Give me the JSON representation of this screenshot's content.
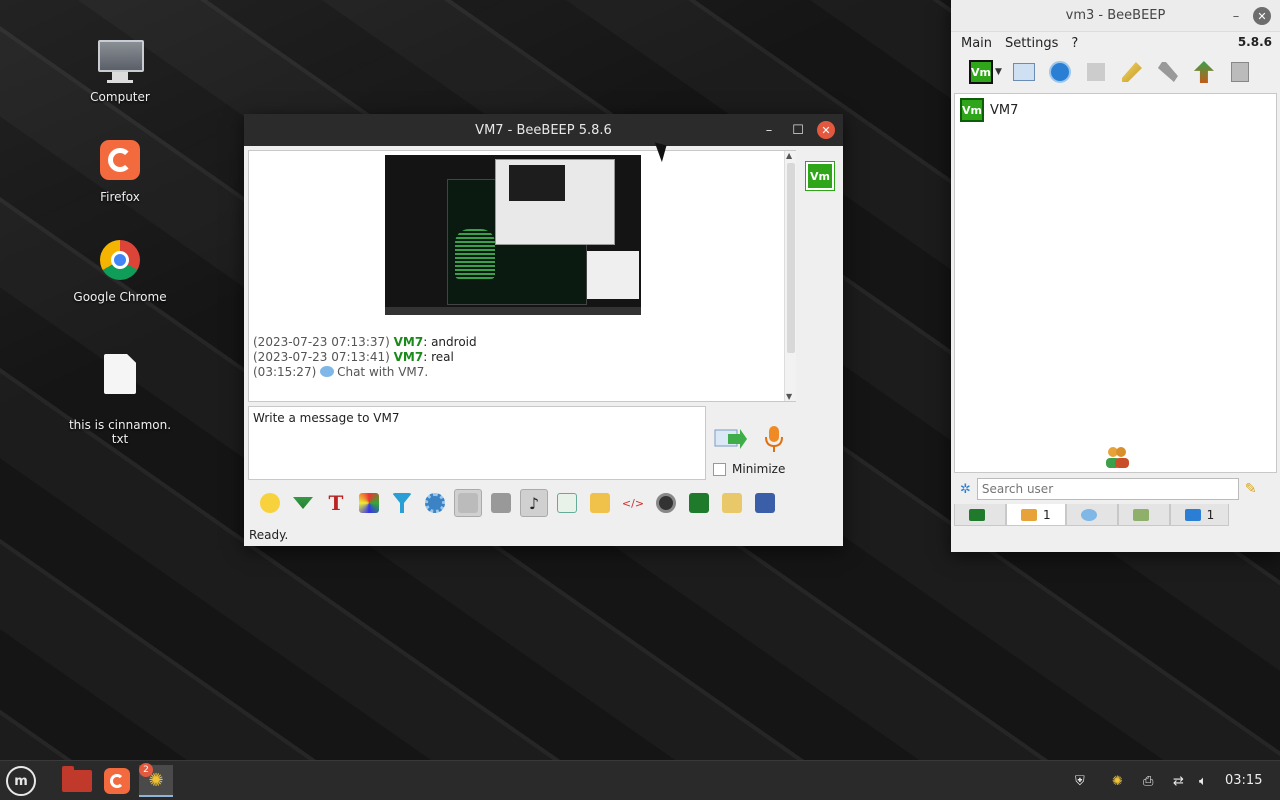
{
  "desktop": {
    "icons": [
      {
        "label": "Computer"
      },
      {
        "label": "Firefox"
      },
      {
        "label": "Google Chrome"
      },
      {
        "label": "this is cinnamon.\ntxt"
      }
    ]
  },
  "chat_window": {
    "title": "VM7 - BeeBEEP 5.8.6",
    "messages": [
      {
        "time": "(2023-07-23 07:13:37)",
        "nick": "VM7",
        "text": ": android"
      },
      {
        "time": "(2023-07-23 07:13:41)",
        "nick": "VM7",
        "text": ": real"
      },
      {
        "time": "(03:15:27)",
        "nick": "",
        "text": "Chat with VM7."
      }
    ],
    "side_avatar": "Vm",
    "input_value": "Write a message to VM7",
    "minimize_label": "Minimize",
    "status": "Ready.",
    "toolbar_icons": [
      "smiley-icon",
      "download-icon",
      "text-format-icon",
      "color-picker-icon",
      "filter-icon",
      "settings-gear-icon",
      "spellcheck-icon",
      "font-icon",
      "music-note-icon",
      "export-doc-icon",
      "folder-icon",
      "html-code-icon",
      "camera-icon",
      "screenshot-icon",
      "edit-note-icon",
      "save-icon"
    ]
  },
  "main_window": {
    "title": "vm3 - BeeBEEP",
    "menu": [
      "Main",
      "Settings",
      "?"
    ],
    "version": "5.8.6",
    "toolbar_avatar": "Vm",
    "users": [
      {
        "badge": "Vm",
        "name": "VM7"
      }
    ],
    "search_placeholder": "Search user",
    "tabs": [
      {
        "count": ""
      },
      {
        "count": "1"
      },
      {
        "count": ""
      },
      {
        "count": ""
      },
      {
        "count": "1"
      }
    ]
  },
  "taskbar": {
    "clock": "03:15",
    "beebeep_badge": "2"
  },
  "colors": {
    "accent_green": "#2fa51a",
    "close_orange": "#e3593f"
  }
}
